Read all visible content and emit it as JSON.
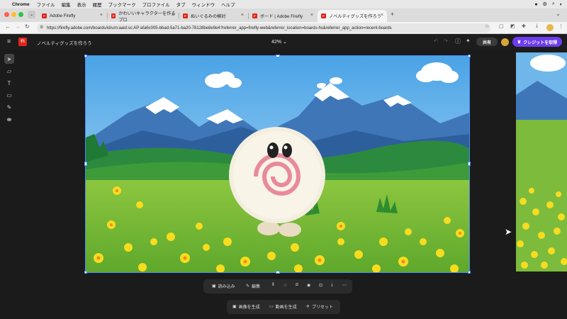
{
  "menubar": {
    "apple": "",
    "app": "Chrome",
    "items": [
      "ファイル",
      "編集",
      "表示",
      "履歴",
      "ブックマーク",
      "プロファイル",
      "タブ",
      "ウィンドウ",
      "ヘルプ"
    ]
  },
  "tabs": [
    {
      "label": "Adobe Firefly"
    },
    {
      "label": "かわいいキャラクターを作るプロ"
    },
    {
      "label": "ぬいぐるみの検討"
    },
    {
      "label": "ボード | Adobe Firefly"
    },
    {
      "label": "ノベルティグッズを作ろう"
    }
  ],
  "address": {
    "url": "https://firefly.adobe.com/boards/id/urn:aaid:sc:AP:afa6c005-bbad-5a71-ba20-78128be8e9e4?referrer_app=firefly-web&referrer_location=boards-hs&referrer_app_action=recent-boards"
  },
  "header": {
    "logo": "Fi",
    "board_title": "ノベルティグッズを作ろう",
    "zoom": "42%",
    "share": "共有",
    "credit": "クレジットを取得"
  },
  "image_toolbar": {
    "import": "読み込み",
    "edit": "編集"
  },
  "gen_toolbar": {
    "image": "画像を生成",
    "video": "動画を生成",
    "preset": "プリセット"
  },
  "colors": {
    "accent": "#6e3cf0",
    "selection": "#4a8df8",
    "firefly_red": "#e1251b"
  }
}
